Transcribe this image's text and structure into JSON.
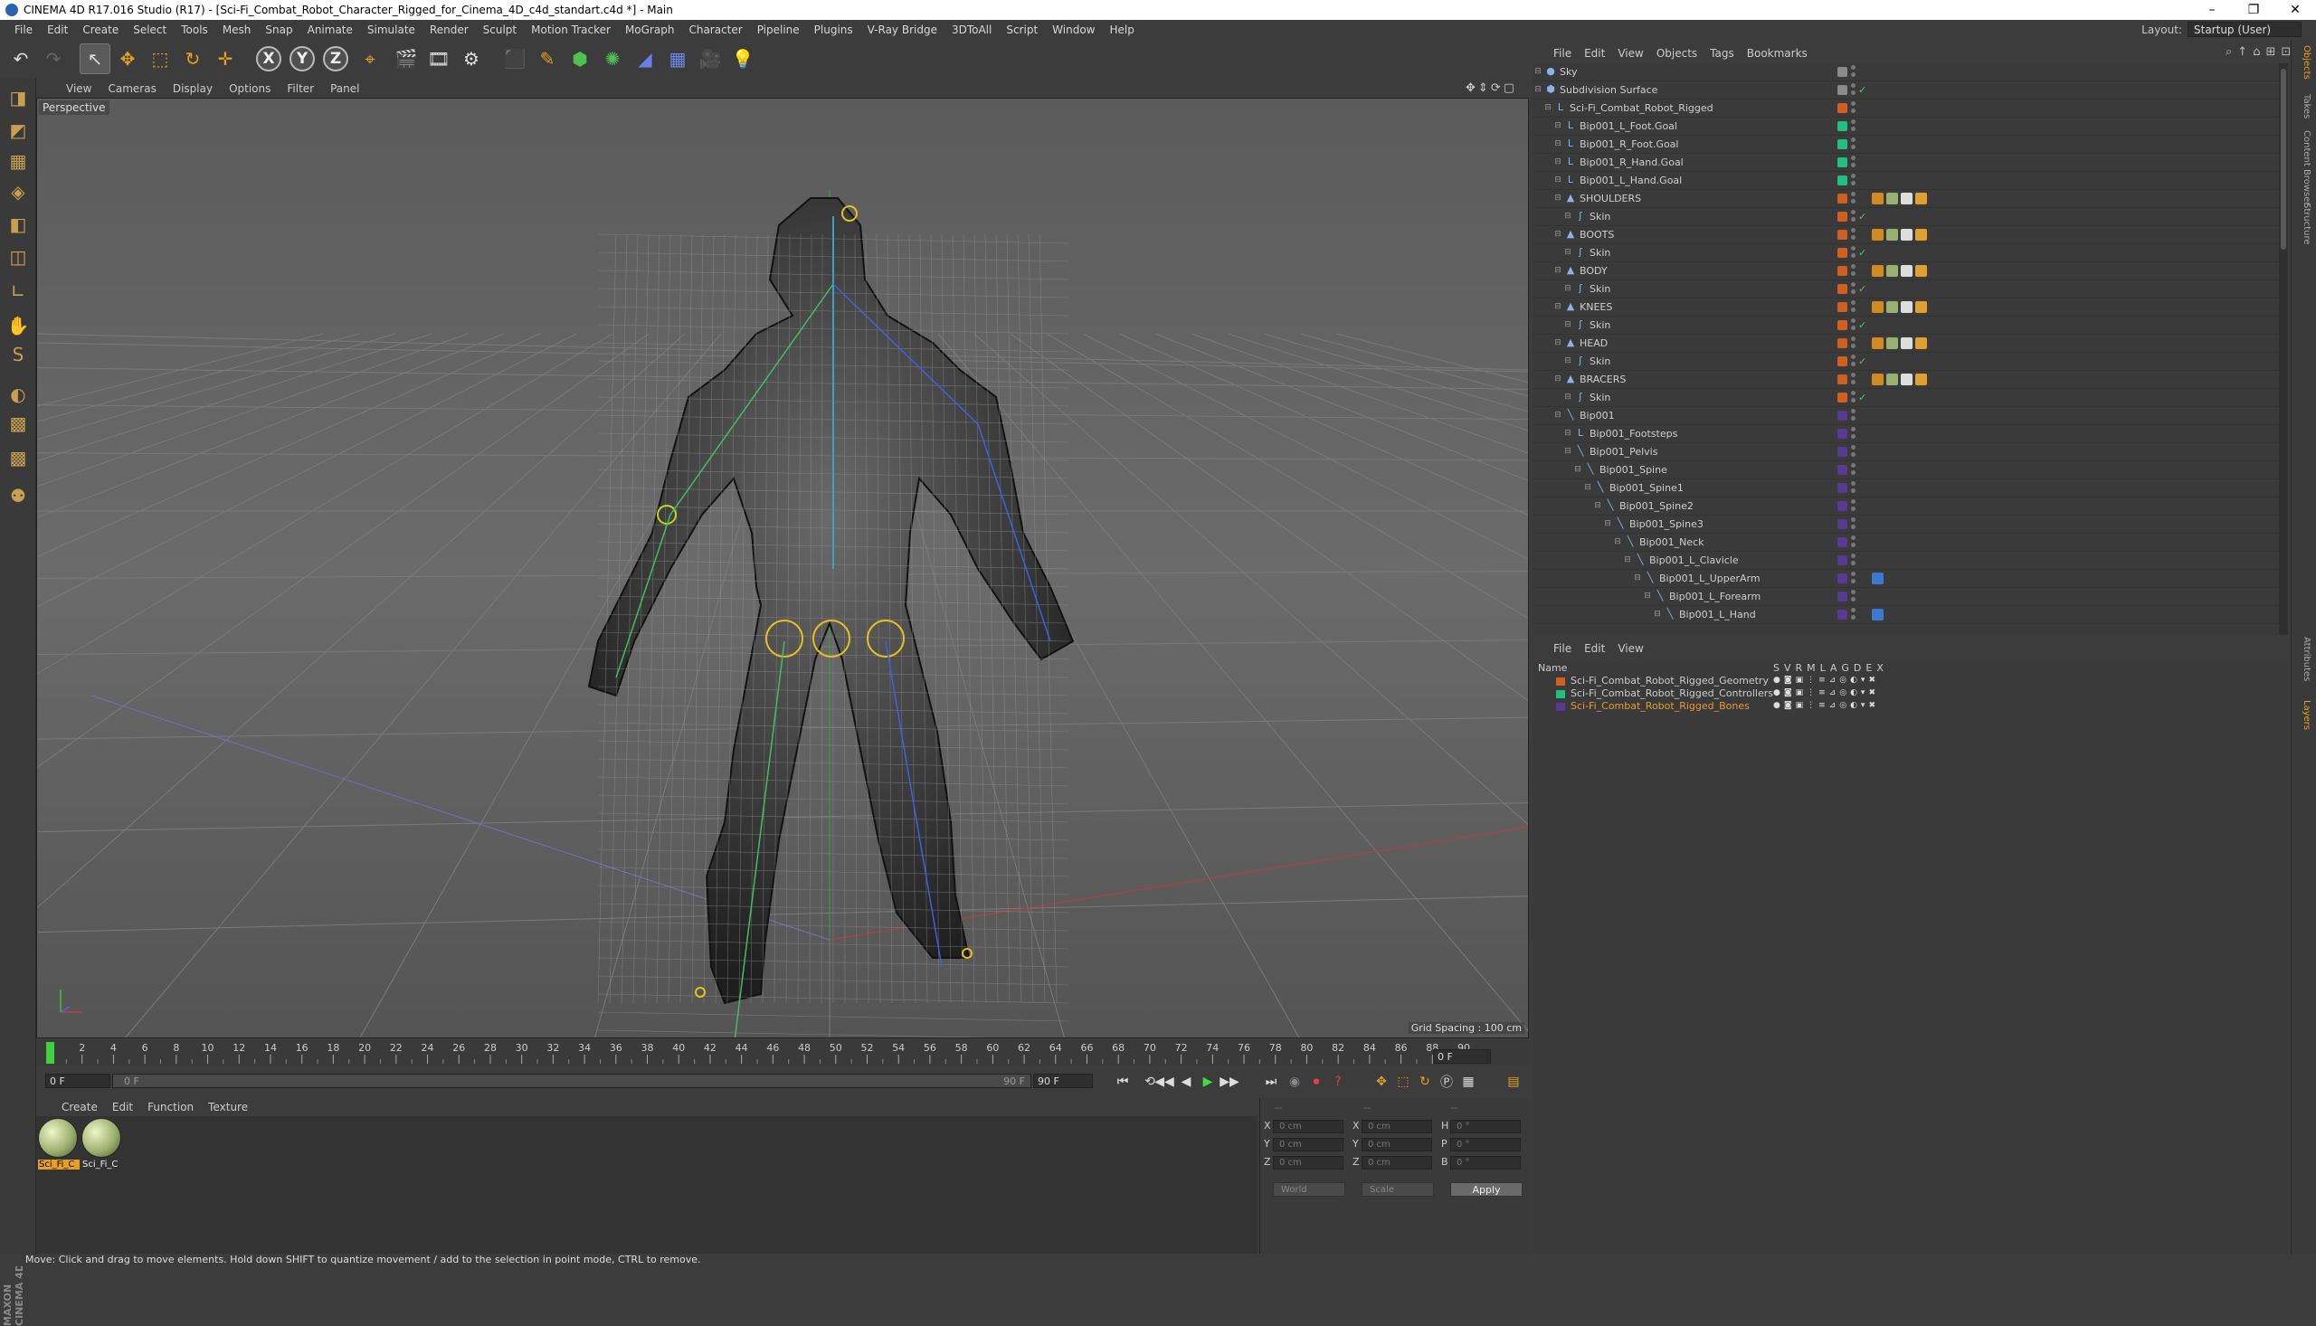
{
  "window": {
    "title": "CINEMA 4D R17.016 Studio (R17) - [Sci-Fi_Combat_Robot_Character_Rigged_for_Cinema_4D_c4d_standart.c4d *] - Main",
    "minimize": "–",
    "restore": "❐",
    "close": "✕"
  },
  "menubar": {
    "items": [
      "File",
      "Edit",
      "Create",
      "Select",
      "Tools",
      "Mesh",
      "Snap",
      "Animate",
      "Simulate",
      "Render",
      "Sculpt",
      "Motion Tracker",
      "MoGraph",
      "Character",
      "Pipeline",
      "Plugins",
      "V-Ray Bridge",
      "3DToAll",
      "Script",
      "Window",
      "Help"
    ],
    "layout_label": "Layout:",
    "layout_value": "Startup (User)"
  },
  "toolbar": {
    "undo": "↶",
    "redo": "↷",
    "select": "↖",
    "move": "✥",
    "scale": "⬚",
    "rotate": "↻",
    "add": "✛",
    "x": "X",
    "y": "Y",
    "z": "Z",
    "coord": "⌖",
    "render_view": "🎬",
    "render_pic": "🎞",
    "render_settings": "⚙",
    "cube": "⬛",
    "pen": "✎",
    "subdiv": "⬢",
    "array": "✺",
    "deformer": "◢",
    "floor": "▦",
    "camera": "🎥",
    "light": "💡"
  },
  "lefttools": [
    "◨",
    "◩",
    "▦",
    "◈",
    "◧",
    "◫",
    "∟",
    "✋",
    "S",
    "◐",
    "▩",
    "▩",
    "⚉"
  ],
  "maxon_logo": "MAXON CINEMA 4D",
  "viewport": {
    "menu": [
      "View",
      "Cameras",
      "Display",
      "Options",
      "Filter",
      "Panel"
    ],
    "label": "Perspective",
    "grid_spacing": "Grid Spacing : 100 cm",
    "nav_icons": [
      "✥",
      "⇕",
      "⟳",
      "▢"
    ]
  },
  "timeline": {
    "ticks": [
      "0",
      "2",
      "4",
      "6",
      "8",
      "10",
      "12",
      "14",
      "16",
      "18",
      "20",
      "22",
      "24",
      "26",
      "28",
      "30",
      "32",
      "34",
      "36",
      "38",
      "40",
      "42",
      "44",
      "46",
      "48",
      "50",
      "52",
      "54",
      "56",
      "58",
      "60",
      "62",
      "64",
      "66",
      "68",
      "70",
      "72",
      "74",
      "76",
      "78",
      "80",
      "82",
      "84",
      "86",
      "88",
      "90"
    ],
    "current_frame": "0 F",
    "start_field": "0 F",
    "range_start": "0 F",
    "range_end": "90 F",
    "end_field": "90 F"
  },
  "transport": [
    "⏮",
    "◀◀",
    "◀",
    "▶",
    "▶▶",
    "⏭",
    "⟲"
  ],
  "material_manager": {
    "menu": [
      "Create",
      "Edit",
      "Function",
      "Texture"
    ],
    "materials": [
      {
        "name": "Sci_Fi_C",
        "selected": true
      },
      {
        "name": "Sci_Fi_C",
        "selected": false
      }
    ]
  },
  "coords": {
    "rows": [
      {
        "a": "X",
        "av": "0 cm",
        "b": "X",
        "bv": "0 cm",
        "c": "H",
        "cv": "0 °"
      },
      {
        "a": "Y",
        "av": "0 cm",
        "b": "Y",
        "bv": "0 cm",
        "c": "P",
        "cv": "0 °"
      },
      {
        "a": "Z",
        "av": "0 cm",
        "b": "Z",
        "bv": "0 cm",
        "c": "B",
        "cv": "0 °"
      }
    ],
    "mode1": "World",
    "mode2": "Scale",
    "apply": "Apply",
    "dashes": "--"
  },
  "statusbar": "Move: Click and drag to move elements. Hold down SHIFT to quantize movement / add to the selection in point mode, CTRL to remove.",
  "object_manager": {
    "menu": [
      "File",
      "Edit",
      "View",
      "Objects",
      "Tags",
      "Bookmarks"
    ],
    "objects": [
      {
        "name": "Sky",
        "indent": 0,
        "icon": "●",
        "tag": "#8a8a8a",
        "check": false,
        "tags": []
      },
      {
        "name": "Subdivision Surface",
        "indent": 0,
        "icon": "⬢",
        "tag": "#8a8a8a",
        "check": true,
        "tags": []
      },
      {
        "name": "Sci-Fi_Combat_Robot_Rigged",
        "indent": 1,
        "icon": "L",
        "tag": "#d06020",
        "check": false,
        "tags": []
      },
      {
        "name": "Bip001_L_Foot.Goal",
        "indent": 2,
        "icon": "L",
        "tag": "#20c080",
        "check": false,
        "tags": []
      },
      {
        "name": "Bip001_R_Foot.Goal",
        "indent": 2,
        "icon": "L",
        "tag": "#20c080",
        "check": false,
        "tags": []
      },
      {
        "name": "Bip001_R_Hand.Goal",
        "indent": 2,
        "icon": "L",
        "tag": "#20c080",
        "check": false,
        "tags": []
      },
      {
        "name": "Bip001_L_Hand.Goal",
        "indent": 2,
        "icon": "L",
        "tag": "#20c080",
        "check": false,
        "tags": []
      },
      {
        "name": "SHOULDERS",
        "indent": 2,
        "icon": "▲",
        "tag": "#d06020",
        "check": false,
        "tags": [
          "#d08a20",
          "#9ab070",
          "#dddddd",
          "#e0a030"
        ]
      },
      {
        "name": "Skin",
        "indent": 3,
        "icon": "ʃ",
        "tag": "#d06020",
        "check": true,
        "tags": []
      },
      {
        "name": "BOOTS",
        "indent": 2,
        "icon": "▲",
        "tag": "#d06020",
        "check": false,
        "tags": [
          "#d08a20",
          "#9ab070",
          "#dddddd",
          "#e0a030"
        ]
      },
      {
        "name": "Skin",
        "indent": 3,
        "icon": "ʃ",
        "tag": "#d06020",
        "check": true,
        "tags": []
      },
      {
        "name": "BODY",
        "indent": 2,
        "icon": "▲",
        "tag": "#d06020",
        "check": false,
        "tags": [
          "#d08a20",
          "#9ab070",
          "#dddddd",
          "#e0a030"
        ]
      },
      {
        "name": "Skin",
        "indent": 3,
        "icon": "ʃ",
        "tag": "#d06020",
        "check": true,
        "tags": []
      },
      {
        "name": "KNEES",
        "indent": 2,
        "icon": "▲",
        "tag": "#d06020",
        "check": false,
        "tags": [
          "#d08a20",
          "#9ab070",
          "#dddddd",
          "#e0a030"
        ]
      },
      {
        "name": "Skin",
        "indent": 3,
        "icon": "ʃ",
        "tag": "#d06020",
        "check": true,
        "tags": []
      },
      {
        "name": "HEAD",
        "indent": 2,
        "icon": "▲",
        "tag": "#d06020",
        "check": false,
        "tags": [
          "#d08a20",
          "#9ab070",
          "#dddddd",
          "#e0a030"
        ]
      },
      {
        "name": "Skin",
        "indent": 3,
        "icon": "ʃ",
        "tag": "#d06020",
        "check": true,
        "tags": []
      },
      {
        "name": "BRACERS",
        "indent": 2,
        "icon": "▲",
        "tag": "#d06020",
        "check": false,
        "tags": [
          "#d08a20",
          "#9ab070",
          "#dddddd",
          "#e0a030"
        ]
      },
      {
        "name": "Skin",
        "indent": 3,
        "icon": "ʃ",
        "tag": "#d06020",
        "check": true,
        "tags": []
      },
      {
        "name": "Bip001",
        "indent": 2,
        "icon": "╲",
        "tag": "#5a3a90",
        "check": false,
        "tags": []
      },
      {
        "name": "Bip001_Footsteps",
        "indent": 3,
        "icon": "L",
        "tag": "#5a3a90",
        "check": false,
        "tags": []
      },
      {
        "name": "Bip001_Pelvis",
        "indent": 3,
        "icon": "╲",
        "tag": "#5a3a90",
        "check": false,
        "tags": []
      },
      {
        "name": "Bip001_Spine",
        "indent": 4,
        "icon": "╲",
        "tag": "#5a3a90",
        "check": false,
        "tags": []
      },
      {
        "name": "Bip001_Spine1",
        "indent": 5,
        "icon": "╲",
        "tag": "#5a3a90",
        "check": false,
        "tags": []
      },
      {
        "name": "Bip001_Spine2",
        "indent": 6,
        "icon": "╲",
        "tag": "#5a3a90",
        "check": false,
        "tags": []
      },
      {
        "name": "Bip001_Spine3",
        "indent": 7,
        "icon": "╲",
        "tag": "#5a3a90",
        "check": false,
        "tags": []
      },
      {
        "name": "Bip001_Neck",
        "indent": 8,
        "icon": "╲",
        "tag": "#5a3a90",
        "check": false,
        "tags": []
      },
      {
        "name": "Bip001_L_Clavicle",
        "indent": 9,
        "icon": "╲",
        "tag": "#5a3a90",
        "check": false,
        "tags": []
      },
      {
        "name": "Bip001_L_UpperArm",
        "indent": 10,
        "icon": "╲",
        "tag": "#5a3a90",
        "check": false,
        "tags": [
          "#3a7ad0"
        ]
      },
      {
        "name": "Bip001_L_Forearm",
        "indent": 11,
        "icon": "╲",
        "tag": "#5a3a90",
        "check": false,
        "tags": []
      },
      {
        "name": "Bip001_L_Hand",
        "indent": 12,
        "icon": "╲",
        "tag": "#5a3a90",
        "check": false,
        "tags": [
          "#3a7ad0"
        ]
      }
    ]
  },
  "layer_manager": {
    "menu": [
      "File",
      "Edit",
      "View"
    ],
    "header_name": "Name",
    "header_flags": [
      "S",
      "V",
      "R",
      "M",
      "L",
      "A",
      "G",
      "D",
      "E",
      "X"
    ],
    "layers": [
      {
        "name": "Sci-Fi_Combat_Robot_Rigged_Geometry",
        "color": "#d06020",
        "text_color": "#cccccc"
      },
      {
        "name": "Sci-Fi_Combat_Robot_Rigged_Controllers",
        "color": "#20c080",
        "text_color": "#cccccc"
      },
      {
        "name": "Sci-Fi_Combat_Robot_Rigged_Bones",
        "color": "#5a3a90",
        "text_color": "#e89a30"
      }
    ]
  },
  "right_rail": [
    {
      "label": "Objects",
      "active": true
    },
    {
      "label": "Takes",
      "active": false
    },
    {
      "label": "Content Browser",
      "active": false
    },
    {
      "label": "Structure",
      "active": false
    },
    {
      "label": "Attributes",
      "active": false
    },
    {
      "label": "Layers",
      "active": true
    }
  ]
}
